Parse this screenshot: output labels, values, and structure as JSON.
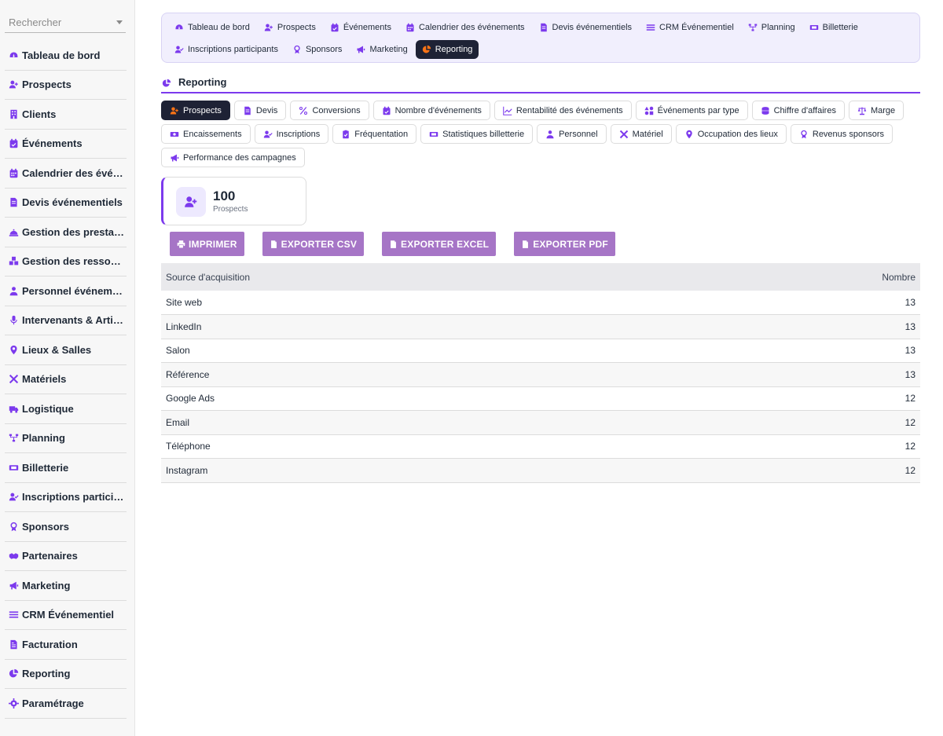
{
  "sidebar": {
    "search_placeholder": "Rechercher",
    "items": [
      {
        "label": "Tableau de bord",
        "icon": "dashboard-icon"
      },
      {
        "label": "Prospects",
        "icon": "user-plus-icon"
      },
      {
        "label": "Clients",
        "icon": "building-icon"
      },
      {
        "label": "Événements",
        "icon": "calendar-check-icon"
      },
      {
        "label": "Calendrier des événements",
        "icon": "calendar-icon"
      },
      {
        "label": "Devis événementiels",
        "icon": "invoice-icon"
      },
      {
        "label": "Gestion des prestations",
        "icon": "bell-concierge-icon"
      },
      {
        "label": "Gestion des ressources",
        "icon": "cubes-icon"
      },
      {
        "label": "Personnel événementiel",
        "icon": "user-tie-icon"
      },
      {
        "label": "Intervenants & Artistes",
        "icon": "microphone-icon"
      },
      {
        "label": "Lieux & Salles",
        "icon": "location-pin-icon"
      },
      {
        "label": "Matériels",
        "icon": "tools-icon"
      },
      {
        "label": "Logistique",
        "icon": "truck-icon"
      },
      {
        "label": "Planning",
        "icon": "sitemap-icon"
      },
      {
        "label": "Billetterie",
        "icon": "ticket-icon"
      },
      {
        "label": "Inscriptions participants",
        "icon": "user-check-icon"
      },
      {
        "label": "Sponsors",
        "icon": "award-icon"
      },
      {
        "label": "Partenaires",
        "icon": "handshake-icon"
      },
      {
        "label": "Marketing",
        "icon": "bullhorn-icon"
      },
      {
        "label": "CRM Événementiel",
        "icon": "bars-icon"
      },
      {
        "label": "Facturation",
        "icon": "file-invoice-icon"
      },
      {
        "label": "Reporting",
        "icon": "chart-pie-icon"
      },
      {
        "label": "Paramétrage",
        "icon": "gear-icon"
      }
    ]
  },
  "topnav": {
    "row1": [
      {
        "label": "Tableau de bord",
        "icon": "dashboard-icon"
      },
      {
        "label": "Prospects",
        "icon": "user-plus-icon"
      },
      {
        "label": "Événements",
        "icon": "calendar-check-icon"
      },
      {
        "label": "Calendrier des événements",
        "icon": "calendar-icon"
      },
      {
        "label": "Devis événementiels",
        "icon": "invoice-icon"
      },
      {
        "label": "CRM Événementiel",
        "icon": "bars-icon"
      },
      {
        "label": "Planning",
        "icon": "sitemap-icon"
      },
      {
        "label": "Billetterie",
        "icon": "ticket-icon"
      }
    ],
    "row2": [
      {
        "label": "Inscriptions participants",
        "icon": "user-check-icon"
      },
      {
        "label": "Sponsors",
        "icon": "award-icon"
      },
      {
        "label": "Marketing",
        "icon": "bullhorn-icon"
      },
      {
        "label": "Reporting",
        "icon": "chart-pie-icon",
        "active": true
      }
    ]
  },
  "section": {
    "title": "Reporting",
    "icon": "chart-pie-icon"
  },
  "report_tabs": {
    "row1": [
      {
        "label": "Prospects",
        "icon": "user-plus-icon",
        "active": true
      },
      {
        "label": "Devis",
        "icon": "invoice-icon"
      },
      {
        "label": "Conversions",
        "icon": "percent-icon"
      },
      {
        "label": "Nombre d'événements",
        "icon": "calendar-check-icon"
      },
      {
        "label": "Rentabilité des événements",
        "icon": "chart-line-icon"
      },
      {
        "label": "Événements par type",
        "icon": "shapes-icon"
      },
      {
        "label": "Chiffre d'affaires",
        "icon": "coins-icon"
      },
      {
        "label": "Marge",
        "icon": "scale-icon"
      }
    ],
    "row2": [
      {
        "label": "Encaissements",
        "icon": "money-bill-icon"
      },
      {
        "label": "Inscriptions",
        "icon": "user-check-icon"
      },
      {
        "label": "Fréquentation",
        "icon": "clipboard-check-icon"
      },
      {
        "label": "Statistiques billetterie",
        "icon": "ticket-icon"
      },
      {
        "label": "Personnel",
        "icon": "user-tie-icon"
      },
      {
        "label": "Matériel",
        "icon": "tools-icon"
      },
      {
        "label": "Occupation des lieux",
        "icon": "location-pin-icon"
      },
      {
        "label": "Revenus sponsors",
        "icon": "award-icon"
      }
    ],
    "row3": [
      {
        "label": "Performance des campagnes",
        "icon": "bullhorn-icon"
      }
    ]
  },
  "stat": {
    "value": "100",
    "label": "Prospects",
    "icon": "user-plus-icon"
  },
  "actions": {
    "print": "IMPRIMER",
    "csv": "EXPORTER CSV",
    "excel": "EXPORTER EXCEL",
    "pdf": "EXPORTER PDF"
  },
  "table": {
    "headers": [
      "Source d'acquisition",
      "Nombre"
    ],
    "rows": [
      {
        "source": "Site web",
        "count": "13"
      },
      {
        "source": "LinkedIn",
        "count": "13"
      },
      {
        "source": "Salon",
        "count": "13"
      },
      {
        "source": "Référence",
        "count": "13"
      },
      {
        "source": "Google Ads",
        "count": "12"
      },
      {
        "source": "Email",
        "count": "12"
      },
      {
        "source": "Téléphone",
        "count": "12"
      },
      {
        "source": "Instagram",
        "count": "12"
      }
    ]
  },
  "colors": {
    "accent": "#7c3aed",
    "active_tab": "#1e2235",
    "button": "#a675c6",
    "reporting_active_icon": "#f97316"
  }
}
